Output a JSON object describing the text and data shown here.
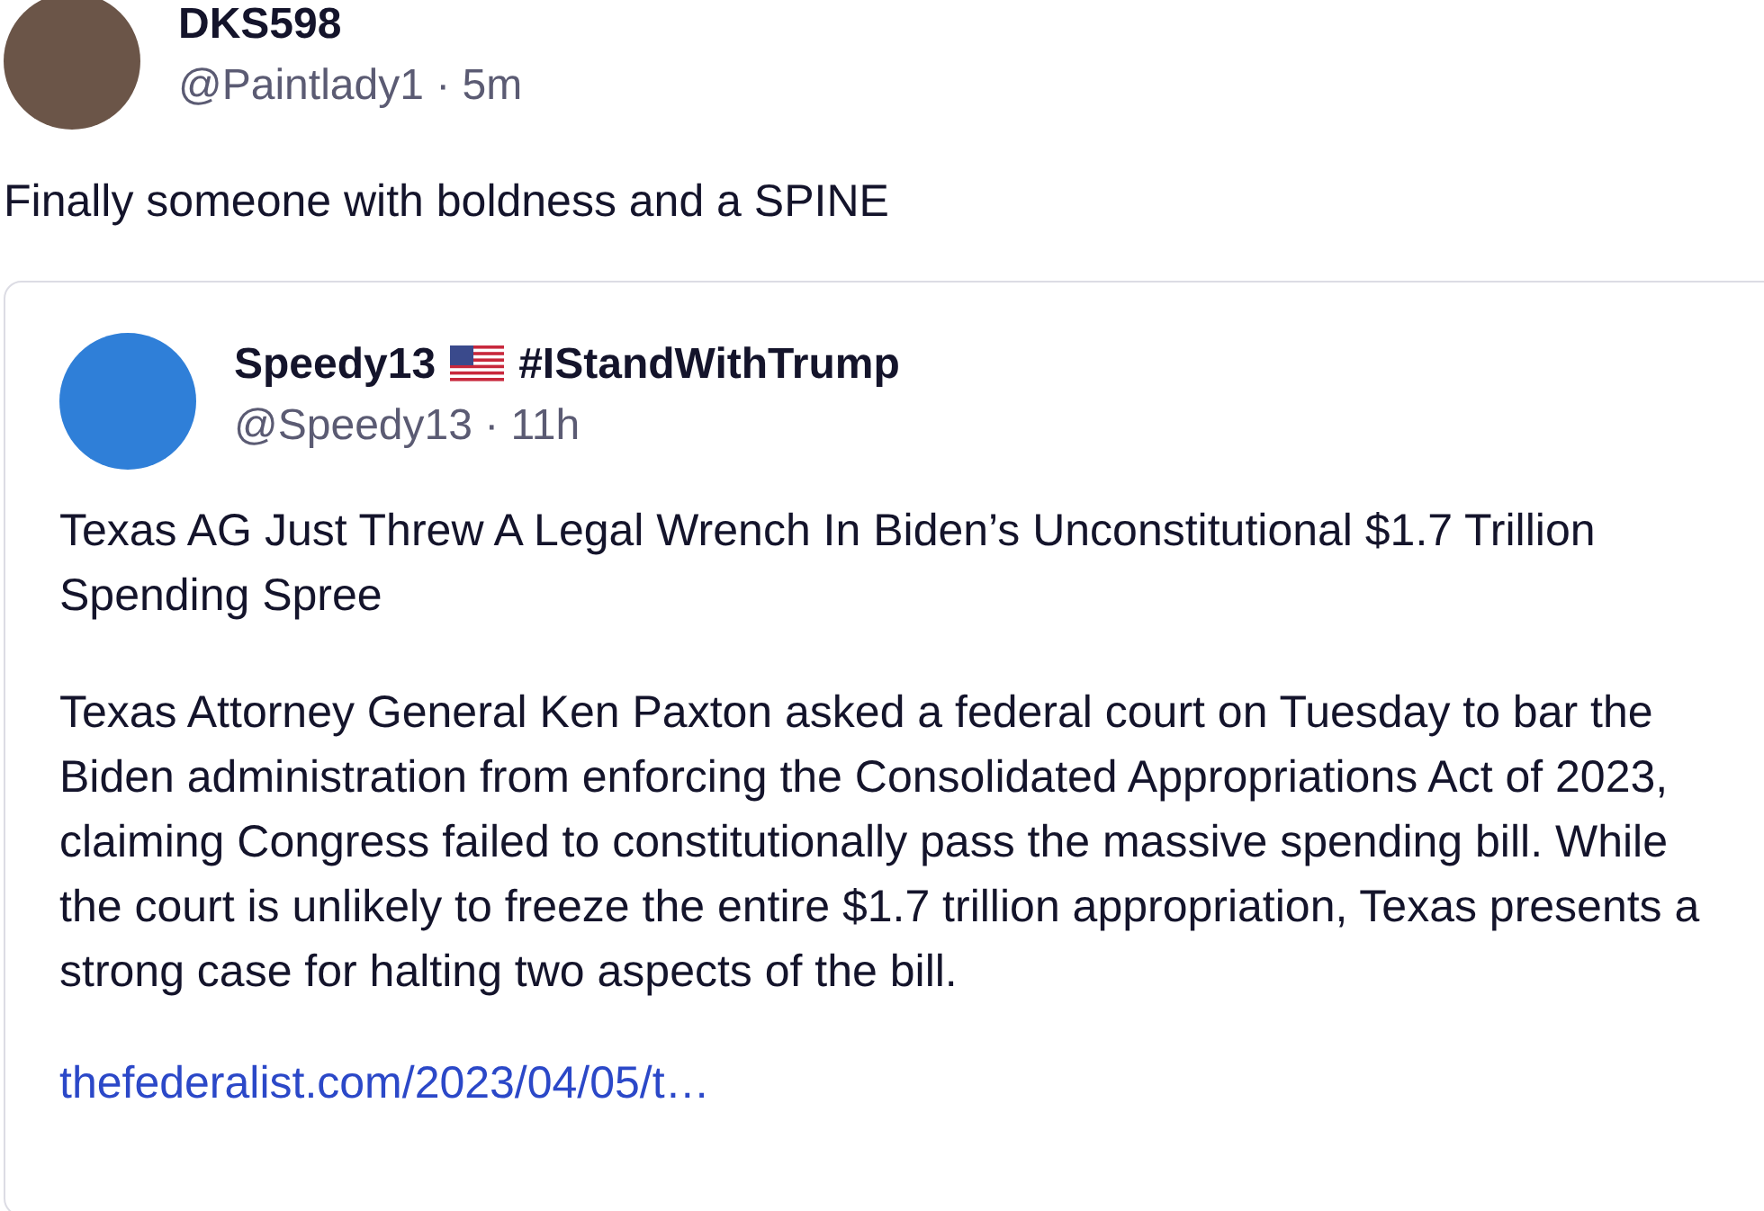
{
  "post": {
    "author": "DKS598",
    "handle_line": "@Paintlady1 · 5m",
    "text": "Finally someone with boldness and a SPINE"
  },
  "quoted": {
    "author": "Speedy13",
    "author_suffix": "#IStandWithTrump",
    "handle_line": "@Speedy13 · 11h",
    "title": "Texas AG Just Threw A Legal Wrench In Biden’s Unconstitutional $1.7 Trillion Spending Spree",
    "body": "Texas Attorney General Ken Paxton asked a federal court on Tuesday to bar the Biden administration from enforcing the Consolidated Appropriations Act of 2023, claiming Congress failed to constitutionally pass the massive spending bill. While the court is unlikely to freeze the entire $1.7 trillion appropriation, Texas presents a strong case for halting two aspects of the bill.",
    "link": "thefederalist.com/2023/04/05/t…"
  }
}
